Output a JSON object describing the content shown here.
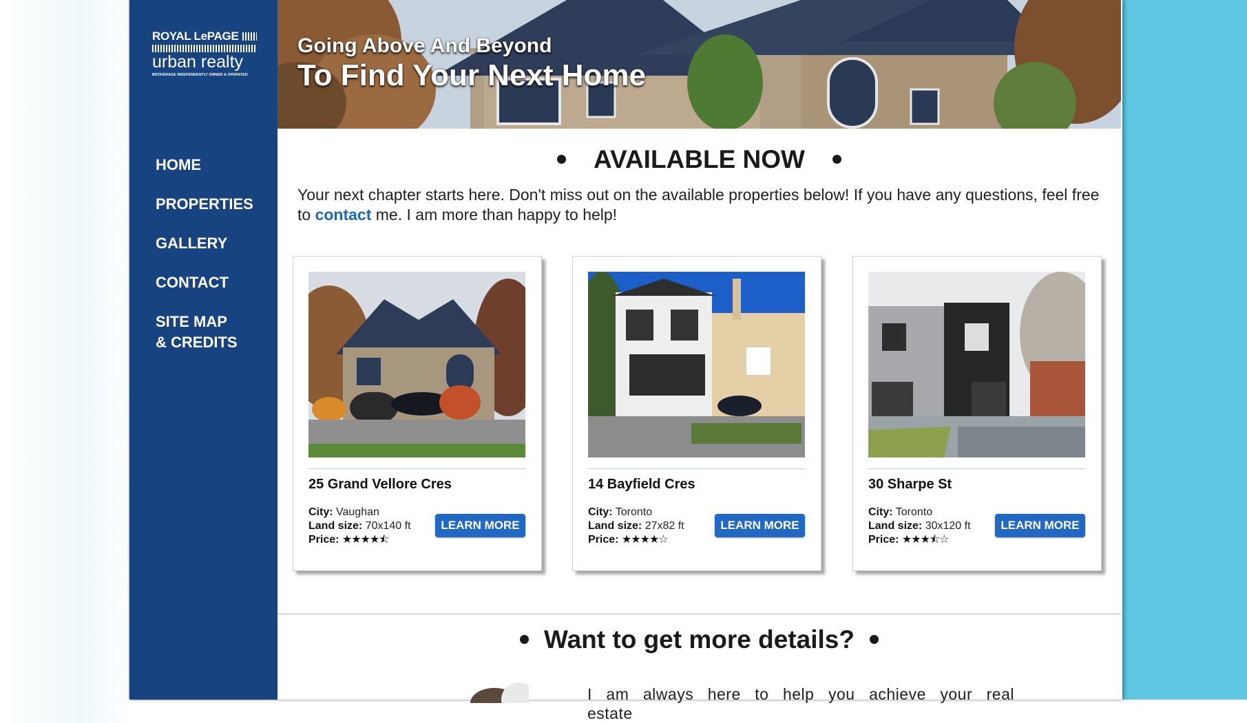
{
  "brand": {
    "line1": "ROYAL LePAGE",
    "line2": "urban realty",
    "tagline": "BROKERAGE INDEPENDENTLY OWNED & OPERATED",
    "color": "#174380"
  },
  "nav": {
    "items": [
      {
        "label": "HOME"
      },
      {
        "label": "PROPERTIES"
      },
      {
        "label": "GALLERY"
      },
      {
        "label": "CONTACT"
      },
      {
        "label": "SITE MAP\n& CREDITS"
      }
    ]
  },
  "hero": {
    "line1": "Going Above And Beyond",
    "line2": "To Find Your Next Home"
  },
  "available": {
    "title": "AVAILABLE NOW",
    "intro_before": "Your next chapter starts here. Don't miss out on the available properties below! If you have any questions, feel free to ",
    "intro_link": "contact",
    "intro_after": " me. I am more than happy to help!"
  },
  "labels": {
    "city": "City:",
    "land": "Land size:",
    "price": "Price:",
    "button": "LEARN MORE"
  },
  "properties": [
    {
      "title": "25 Grand Vellore Cres",
      "city": "Vaughan",
      "land_size": "70x140 ft",
      "price_stars": "★★★★⯪",
      "price_rating": 4.5
    },
    {
      "title": "14 Bayfield Cres",
      "city": "Toronto",
      "land_size": "27x82 ft",
      "price_stars": "★★★★☆",
      "price_rating": 4
    },
    {
      "title": "30 Sharpe St",
      "city": "Toronto",
      "land_size": "30x120 ft",
      "price_stars": "★★★⯪☆",
      "price_rating": 3.5
    }
  ],
  "details": {
    "title": "Want to get more details?",
    "text": "I am always here to help you achieve your real estate"
  },
  "colors": {
    "button": "#2168c4",
    "link": "#2067b3",
    "right_bg": "#5fc7e1"
  }
}
